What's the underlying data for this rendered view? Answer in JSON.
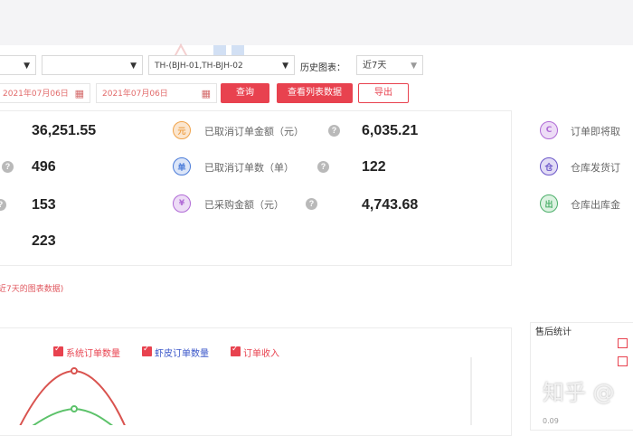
{
  "filters": {
    "select_1_value": "",
    "select_2_value": "",
    "select_3_value": "TH-(BJH-01,TH-BJH-02",
    "history_label": "历史图表：",
    "history_value": "近7天"
  },
  "dates": {
    "start": "2021年07月06日",
    "end": "2021年07月06日"
  },
  "buttons": {
    "query": "查询",
    "view_list": "查看列表数据",
    "export": "导出"
  },
  "stats_left": [
    "36,251.55",
    "496",
    "153",
    "223"
  ],
  "stats_mid": [
    {
      "label": "已取消订单金额（元）",
      "value": "6,035.21",
      "icon": "coin-icon",
      "color": "#f0a34a",
      "glyph": "元"
    },
    {
      "label": "已取消订单数（单）",
      "value": "122",
      "icon": "document-icon",
      "color": "#4a7bd8",
      "glyph": "单"
    },
    {
      "label": "已采购金额（元）",
      "value": "4,743.68",
      "icon": "purchase-icon",
      "color": "#b06ad6",
      "glyph": "¥"
    }
  ],
  "stats_right": [
    {
      "label": "订单即将取",
      "icon": "clock-icon",
      "color": "#b06ad6",
      "glyph": "C"
    },
    {
      "label": "仓库发货订",
      "icon": "warehouse-icon",
      "color": "#6a55c8",
      "glyph": "仓"
    },
    {
      "label": "仓库出库金",
      "icon": "outbound-icon",
      "color": "#4caf6a",
      "glyph": "出"
    }
  ],
  "note": "近7天的图表数据)",
  "legend": [
    {
      "label": "系统订单数量",
      "color": "#e8424f"
    },
    {
      "label": "虾皮订单数量",
      "color": "#3a56c9"
    },
    {
      "label": "订单收入",
      "color": "#e8424f"
    }
  ],
  "sales_panel": {
    "title": "售后统计",
    "axis_label": "0.09"
  },
  "watermark": "知乎 @",
  "colors": {
    "accent_red": "#e8424f",
    "line_red": "#d9534f",
    "line_green": "#5cc26a"
  }
}
